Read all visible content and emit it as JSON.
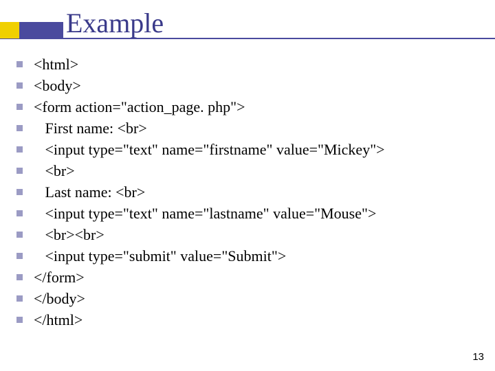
{
  "title": "Example",
  "lines": [
    "<html>",
    "<body>",
    "<form action=\"action_page. php\">",
    "   First name: <br>",
    "   <input type=\"text\" name=\"firstname\" value=\"Mickey\">",
    "   <br>",
    "   Last name: <br>",
    "   <input type=\"text\" name=\"lastname\" value=\"Mouse\">",
    "   <br><br>",
    "   <input type=\"submit\" value=\"Submit\">",
    "</form>",
    "</body>",
    "</html>"
  ],
  "page_number": "13"
}
